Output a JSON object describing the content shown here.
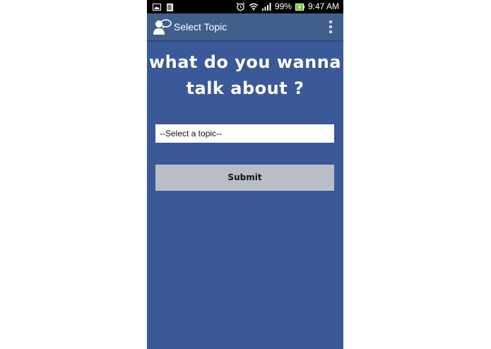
{
  "status_bar": {
    "battery_percent": "99%",
    "time": "9:47 AM",
    "icons": [
      "image-icon",
      "sim-card-icon",
      "alarm-icon",
      "wifi-icon",
      "signal-icon",
      "battery-charging-icon"
    ]
  },
  "action_bar": {
    "title": "Select Topic",
    "app_icon": "chat-person-icon",
    "overflow_icon": "overflow-menu-icon"
  },
  "main": {
    "headline": "what do you wanna talk about ?",
    "topic_select": {
      "selected": "--Select a topic--"
    },
    "submit_label": "Submit"
  },
  "colors": {
    "background": "#3b5998",
    "action_bar": "#3f5f8a",
    "status_bar": "#000000",
    "submit_button": "#b9bec6",
    "select_bg": "#ffffff",
    "headline_text": "#ffffff"
  }
}
